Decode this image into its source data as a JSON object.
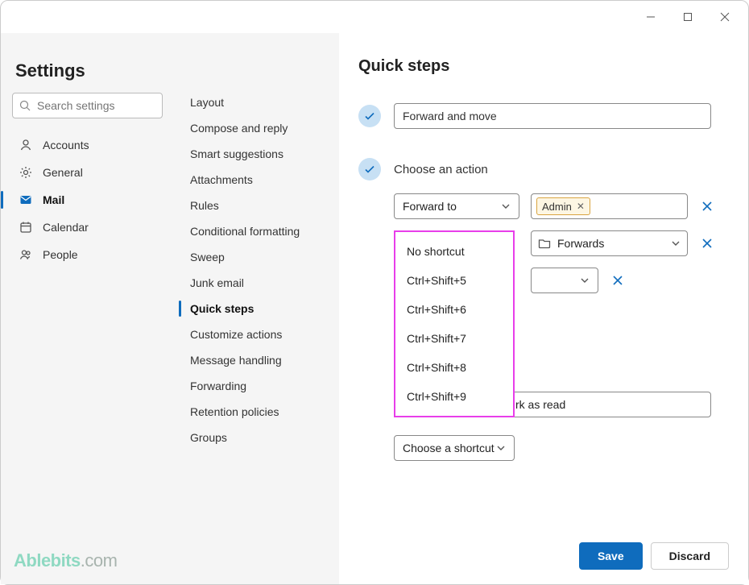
{
  "window": {
    "minimize": "—",
    "maximize": "□",
    "close": "✕"
  },
  "sidebar": {
    "title": "Settings",
    "search_placeholder": "Search settings",
    "items": [
      {
        "label": "Accounts",
        "icon": "person"
      },
      {
        "label": "General",
        "icon": "gear"
      },
      {
        "label": "Mail",
        "icon": "mail",
        "selected": true
      },
      {
        "label": "Calendar",
        "icon": "calendar"
      },
      {
        "label": "People",
        "icon": "people"
      }
    ],
    "watermark_brand": "Ablebits",
    "watermark_suffix": ".com"
  },
  "midnav": {
    "items": [
      "Layout",
      "Compose and reply",
      "Smart suggestions",
      "Attachments",
      "Rules",
      "Conditional formatting",
      "Sweep",
      "Junk email",
      "Quick steps",
      "Customize actions",
      "Message handling",
      "Forwarding",
      "Retention policies",
      "Groups"
    ],
    "selected_index": 8
  },
  "main": {
    "title": "Quick steps",
    "name_value": "Forward and move",
    "choose_action_label": "Choose an action",
    "action1_label": "Forward to",
    "action1_chip": "Admin",
    "folder_label": "Forwards",
    "mark_read_label": "rk as read",
    "shortcut_dd_label": "Choose a shortcut",
    "shortcut_options": [
      "No shortcut",
      "Ctrl+Shift+5",
      "Ctrl+Shift+6",
      "Ctrl+Shift+7",
      "Ctrl+Shift+8",
      "Ctrl+Shift+9"
    ]
  },
  "footer": {
    "save": "Save",
    "discard": "Discard"
  }
}
